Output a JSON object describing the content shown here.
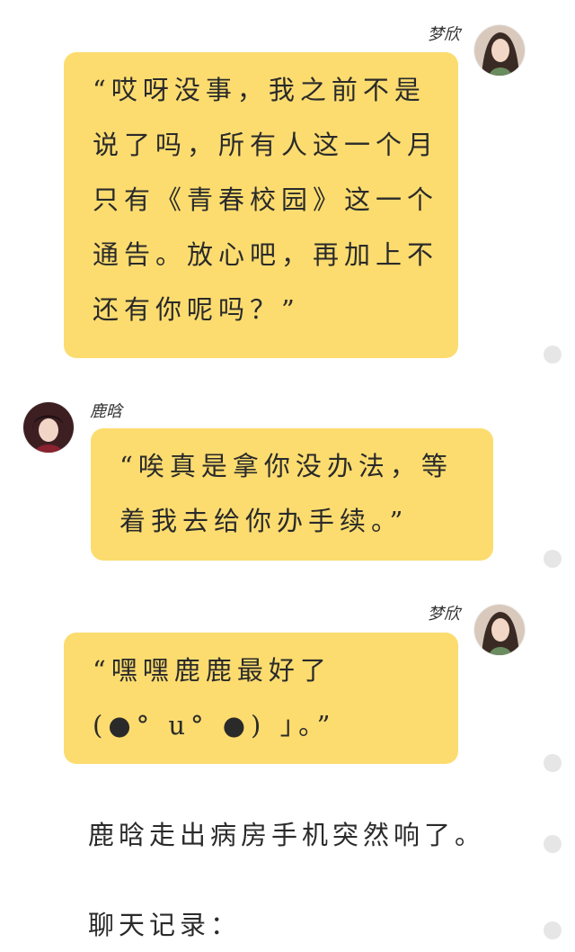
{
  "messages": [
    {
      "sender": "梦欣",
      "side": "right",
      "avatar_icon": "girl-portrait-avatar",
      "text": "“哎呀没事，我之前不是\n说了吗，所有人这一个月\n只有《青春校园》这一个\n通告。放心吧，再加上不\n还有你呢吗？”"
    },
    {
      "sender": "鹿晗",
      "side": "left",
      "avatar_icon": "boy-portrait-avatar",
      "text": "“唉真是拿你没办法，等\n着我去给你办手续。”"
    },
    {
      "sender": "梦欣",
      "side": "right",
      "avatar_icon": "girl-portrait-avatar",
      "text": "“嘿嘿鹿鹿最好了\n(●° u° ●) 」。”"
    }
  ],
  "narration": [
    "鹿晗走出病房手机突然响了。",
    "聊天记录："
  ],
  "colors": {
    "bubble": "#fcdc6f",
    "background": "#ffffff",
    "side_dot": "#e6e6e6"
  }
}
